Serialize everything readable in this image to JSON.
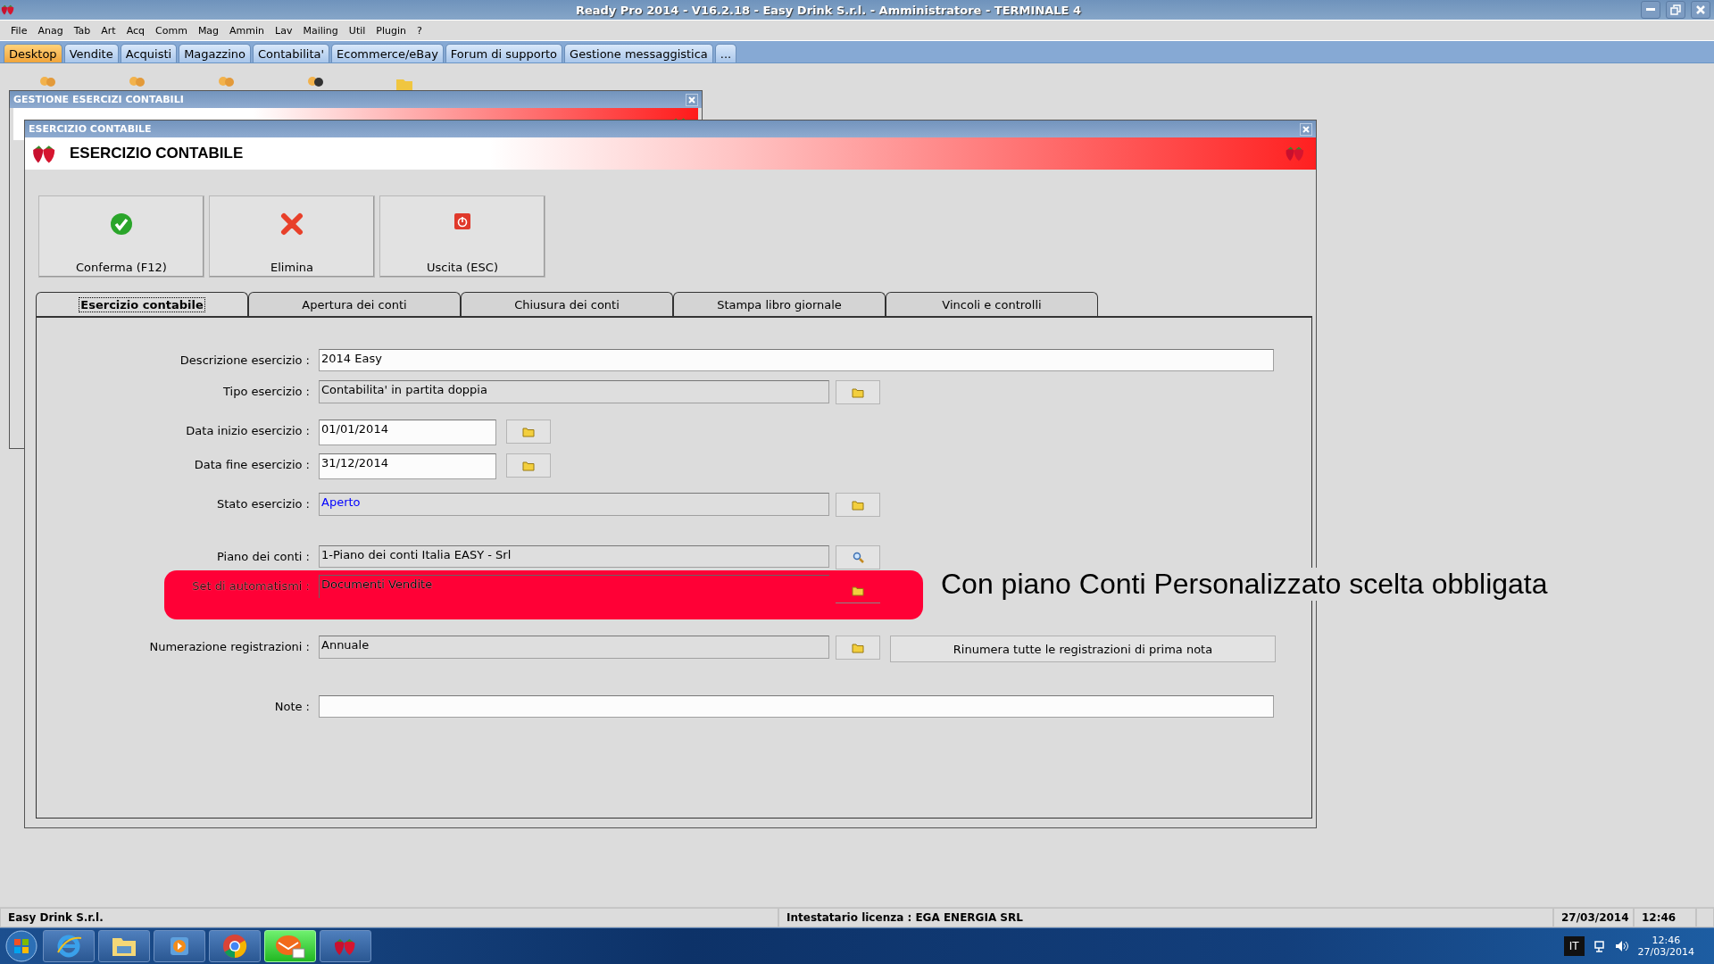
{
  "window": {
    "title": "Ready Pro 2014 - V16.2.18 - Easy Drink S.r.l. - Amministratore - TERMINALE 4"
  },
  "menu": [
    "File",
    "Anag",
    "Tab",
    "Art",
    "Acq",
    "Comm",
    "Mag",
    "Ammin",
    "Lav",
    "Mailing",
    "Util",
    "Plugin",
    "?"
  ],
  "main_tabs": [
    {
      "label": "Desktop",
      "selected": true
    },
    {
      "label": "Vendite",
      "selected": false
    },
    {
      "label": "Acquisti",
      "selected": false
    },
    {
      "label": "Magazzino",
      "selected": false
    },
    {
      "label": "Contabilita'",
      "selected": false
    },
    {
      "label": "Ecommerce/eBay",
      "selected": false
    },
    {
      "label": "Forum di supporto",
      "selected": false
    },
    {
      "label": "Gestione messaggistica",
      "selected": false
    },
    {
      "label": "...",
      "selected": false
    }
  ],
  "background_window": {
    "title": "GESTIONE ESERCIZI CONTABILI"
  },
  "dialog": {
    "title": "ESERCIZIO CONTABILE",
    "header": "ESERCIZIO CONTABILE",
    "actions": [
      {
        "label": "Conferma (F12)",
        "kind": "confirm"
      },
      {
        "label": "Elimina",
        "kind": "delete"
      },
      {
        "label": "Uscita (ESC)",
        "kind": "exit"
      }
    ],
    "tabs": [
      {
        "label": "Esercizio contabile",
        "selected": true
      },
      {
        "label": "Apertura dei conti",
        "selected": false
      },
      {
        "label": "Chiusura dei conti",
        "selected": false
      },
      {
        "label": "Stampa libro giornale",
        "selected": false
      },
      {
        "label": "Vincoli e controlli",
        "selected": false
      }
    ],
    "fields": [
      {
        "label": "Descrizione esercizio :",
        "value": "2014 Easy",
        "kind": "text",
        "highlighted": false
      },
      {
        "label": "Tipo esercizio :",
        "value": "Contabilita' in partita doppia",
        "kind": "lookup",
        "highlighted": false
      },
      {
        "label": "Data inizio esercizio :",
        "value": "01/01/2014",
        "kind": "date",
        "highlighted": false
      },
      {
        "label": "Data fine esercizio :",
        "value": "31/12/2014",
        "kind": "date",
        "highlighted": false
      },
      {
        "label": "Stato esercizio :",
        "value": "Aperto",
        "kind": "lookup",
        "highlighted": false,
        "color": "#0000ff"
      },
      {
        "label": "Piano dei conti :",
        "value": "1-Piano dei conti Italia EASY - Srl",
        "kind": "search",
        "highlighted": false
      },
      {
        "label": "Set di automatismi :",
        "value": "Documenti Vendite",
        "kind": "lookup",
        "highlighted": true
      },
      {
        "label": "Numerazione registrazioni :",
        "value": "Annuale",
        "kind": "lookup",
        "highlighted": false,
        "extra_button": "Rinumera tutte le registrazioni di prima nota"
      },
      {
        "label": "Note :",
        "kind": "text",
        "highlighted": false
      }
    ]
  },
  "annotation": "Con piano Conti Personalizzato scelta obbligata",
  "status_bar": {
    "company": "Easy Drink S.r.l.",
    "license": "Intestatario licenza : EGA ENERGIA SRL",
    "date": "27/03/2014",
    "time": "12:46"
  },
  "taskbar": {
    "apps": [
      {
        "kind": "browser",
        "highlighted": false
      },
      {
        "kind": "files",
        "highlighted": false
      },
      {
        "kind": "media",
        "highlighted": false
      },
      {
        "kind": "chrome",
        "highlighted": false
      },
      {
        "kind": "mail",
        "highlighted": true
      },
      {
        "kind": "app",
        "highlighted": false
      }
    ],
    "language": "IT",
    "time": "12:46",
    "date": "27/03/2014"
  }
}
